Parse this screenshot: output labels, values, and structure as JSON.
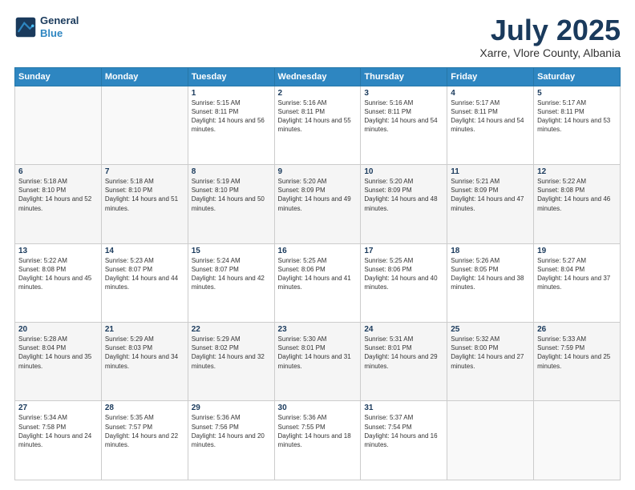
{
  "header": {
    "logo_line1": "General",
    "logo_line2": "Blue",
    "month_title": "July 2025",
    "location": "Xarre, Vlore County, Albania"
  },
  "weekdays": [
    "Sunday",
    "Monday",
    "Tuesday",
    "Wednesday",
    "Thursday",
    "Friday",
    "Saturday"
  ],
  "weeks": [
    [
      {
        "day": "",
        "sunrise": "",
        "sunset": "",
        "daylight": ""
      },
      {
        "day": "",
        "sunrise": "",
        "sunset": "",
        "daylight": ""
      },
      {
        "day": "1",
        "sunrise": "Sunrise: 5:15 AM",
        "sunset": "Sunset: 8:11 PM",
        "daylight": "Daylight: 14 hours and 56 minutes."
      },
      {
        "day": "2",
        "sunrise": "Sunrise: 5:16 AM",
        "sunset": "Sunset: 8:11 PM",
        "daylight": "Daylight: 14 hours and 55 minutes."
      },
      {
        "day": "3",
        "sunrise": "Sunrise: 5:16 AM",
        "sunset": "Sunset: 8:11 PM",
        "daylight": "Daylight: 14 hours and 54 minutes."
      },
      {
        "day": "4",
        "sunrise": "Sunrise: 5:17 AM",
        "sunset": "Sunset: 8:11 PM",
        "daylight": "Daylight: 14 hours and 54 minutes."
      },
      {
        "day": "5",
        "sunrise": "Sunrise: 5:17 AM",
        "sunset": "Sunset: 8:11 PM",
        "daylight": "Daylight: 14 hours and 53 minutes."
      }
    ],
    [
      {
        "day": "6",
        "sunrise": "Sunrise: 5:18 AM",
        "sunset": "Sunset: 8:10 PM",
        "daylight": "Daylight: 14 hours and 52 minutes."
      },
      {
        "day": "7",
        "sunrise": "Sunrise: 5:18 AM",
        "sunset": "Sunset: 8:10 PM",
        "daylight": "Daylight: 14 hours and 51 minutes."
      },
      {
        "day": "8",
        "sunrise": "Sunrise: 5:19 AM",
        "sunset": "Sunset: 8:10 PM",
        "daylight": "Daylight: 14 hours and 50 minutes."
      },
      {
        "day": "9",
        "sunrise": "Sunrise: 5:20 AM",
        "sunset": "Sunset: 8:09 PM",
        "daylight": "Daylight: 14 hours and 49 minutes."
      },
      {
        "day": "10",
        "sunrise": "Sunrise: 5:20 AM",
        "sunset": "Sunset: 8:09 PM",
        "daylight": "Daylight: 14 hours and 48 minutes."
      },
      {
        "day": "11",
        "sunrise": "Sunrise: 5:21 AM",
        "sunset": "Sunset: 8:09 PM",
        "daylight": "Daylight: 14 hours and 47 minutes."
      },
      {
        "day": "12",
        "sunrise": "Sunrise: 5:22 AM",
        "sunset": "Sunset: 8:08 PM",
        "daylight": "Daylight: 14 hours and 46 minutes."
      }
    ],
    [
      {
        "day": "13",
        "sunrise": "Sunrise: 5:22 AM",
        "sunset": "Sunset: 8:08 PM",
        "daylight": "Daylight: 14 hours and 45 minutes."
      },
      {
        "day": "14",
        "sunrise": "Sunrise: 5:23 AM",
        "sunset": "Sunset: 8:07 PM",
        "daylight": "Daylight: 14 hours and 44 minutes."
      },
      {
        "day": "15",
        "sunrise": "Sunrise: 5:24 AM",
        "sunset": "Sunset: 8:07 PM",
        "daylight": "Daylight: 14 hours and 42 minutes."
      },
      {
        "day": "16",
        "sunrise": "Sunrise: 5:25 AM",
        "sunset": "Sunset: 8:06 PM",
        "daylight": "Daylight: 14 hours and 41 minutes."
      },
      {
        "day": "17",
        "sunrise": "Sunrise: 5:25 AM",
        "sunset": "Sunset: 8:06 PM",
        "daylight": "Daylight: 14 hours and 40 minutes."
      },
      {
        "day": "18",
        "sunrise": "Sunrise: 5:26 AM",
        "sunset": "Sunset: 8:05 PM",
        "daylight": "Daylight: 14 hours and 38 minutes."
      },
      {
        "day": "19",
        "sunrise": "Sunrise: 5:27 AM",
        "sunset": "Sunset: 8:04 PM",
        "daylight": "Daylight: 14 hours and 37 minutes."
      }
    ],
    [
      {
        "day": "20",
        "sunrise": "Sunrise: 5:28 AM",
        "sunset": "Sunset: 8:04 PM",
        "daylight": "Daylight: 14 hours and 35 minutes."
      },
      {
        "day": "21",
        "sunrise": "Sunrise: 5:29 AM",
        "sunset": "Sunset: 8:03 PM",
        "daylight": "Daylight: 14 hours and 34 minutes."
      },
      {
        "day": "22",
        "sunrise": "Sunrise: 5:29 AM",
        "sunset": "Sunset: 8:02 PM",
        "daylight": "Daylight: 14 hours and 32 minutes."
      },
      {
        "day": "23",
        "sunrise": "Sunrise: 5:30 AM",
        "sunset": "Sunset: 8:01 PM",
        "daylight": "Daylight: 14 hours and 31 minutes."
      },
      {
        "day": "24",
        "sunrise": "Sunrise: 5:31 AM",
        "sunset": "Sunset: 8:01 PM",
        "daylight": "Daylight: 14 hours and 29 minutes."
      },
      {
        "day": "25",
        "sunrise": "Sunrise: 5:32 AM",
        "sunset": "Sunset: 8:00 PM",
        "daylight": "Daylight: 14 hours and 27 minutes."
      },
      {
        "day": "26",
        "sunrise": "Sunrise: 5:33 AM",
        "sunset": "Sunset: 7:59 PM",
        "daylight": "Daylight: 14 hours and 25 minutes."
      }
    ],
    [
      {
        "day": "27",
        "sunrise": "Sunrise: 5:34 AM",
        "sunset": "Sunset: 7:58 PM",
        "daylight": "Daylight: 14 hours and 24 minutes."
      },
      {
        "day": "28",
        "sunrise": "Sunrise: 5:35 AM",
        "sunset": "Sunset: 7:57 PM",
        "daylight": "Daylight: 14 hours and 22 minutes."
      },
      {
        "day": "29",
        "sunrise": "Sunrise: 5:36 AM",
        "sunset": "Sunset: 7:56 PM",
        "daylight": "Daylight: 14 hours and 20 minutes."
      },
      {
        "day": "30",
        "sunrise": "Sunrise: 5:36 AM",
        "sunset": "Sunset: 7:55 PM",
        "daylight": "Daylight: 14 hours and 18 minutes."
      },
      {
        "day": "31",
        "sunrise": "Sunrise: 5:37 AM",
        "sunset": "Sunset: 7:54 PM",
        "daylight": "Daylight: 14 hours and 16 minutes."
      },
      {
        "day": "",
        "sunrise": "",
        "sunset": "",
        "daylight": ""
      },
      {
        "day": "",
        "sunrise": "",
        "sunset": "",
        "daylight": ""
      }
    ]
  ]
}
